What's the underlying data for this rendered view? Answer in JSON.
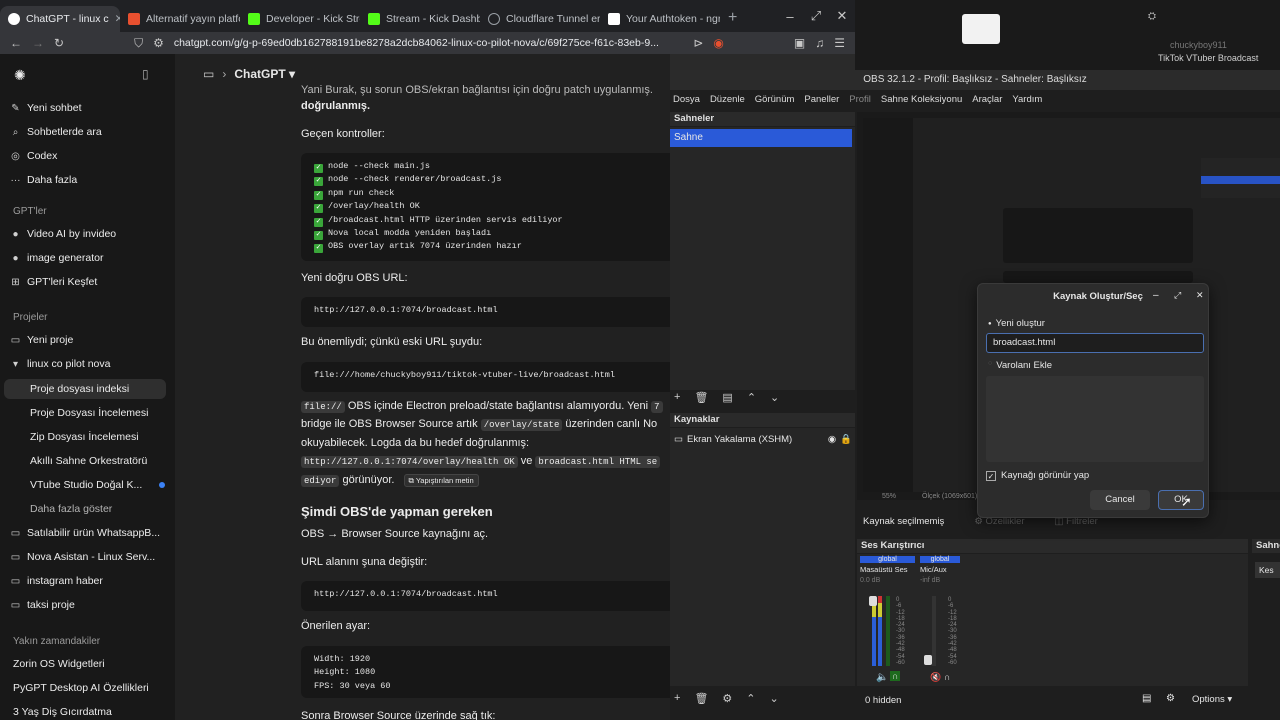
{
  "browser": {
    "tabs": [
      {
        "label": "ChatGPT - linux c",
        "color": "#ffffff",
        "active": true
      },
      {
        "label": "Alternatif yayın platfo",
        "color": "#e8502f"
      },
      {
        "label": "Developer - Kick Stre",
        "color": "#53fc18"
      },
      {
        "label": "Stream - Kick Dashb",
        "color": "#53fc18"
      },
      {
        "label": "Cloudflare Tunnel er",
        "color": "#9aa0a6"
      },
      {
        "label": "Your Authtoken - ngr",
        "color": "#ffffff"
      }
    ],
    "new_tab": "+",
    "url": "chatgpt.com/g/g-p-69ed0db162788191be8278a2dcb84062-linux-co-pilot-nova/c/69f275ce-f61c-83eb-9..."
  },
  "desktop": {
    "tiktok_title": "TikTok VTuber Broadcast",
    "top_right_text": "chuckyboy911"
  },
  "sidebar": {
    "top": [
      {
        "label": "Yeni sohbet",
        "icon": "edit-icon"
      },
      {
        "label": "Sohbetlerde ara",
        "icon": "search-icon"
      },
      {
        "label": "Codex",
        "icon": "codex-icon"
      },
      {
        "label": "Daha fazla",
        "icon": "more-icon"
      }
    ],
    "gpts_head": "GPT'ler",
    "gpts": [
      {
        "label": "Video AI by invideo"
      },
      {
        "label": "image generator"
      },
      {
        "label": "GPT'leri Keşfet"
      }
    ],
    "projects_head": "Projeler",
    "projects": [
      {
        "label": "Yeni proje"
      },
      {
        "label": "linux co pilot nova"
      },
      {
        "label": "Proje dosyası indeksi"
      },
      {
        "label": "Proje Dosyası İncelemesi"
      },
      {
        "label": "Zip Dosyası İncelemesi"
      },
      {
        "label": "Akıllı Sahne Orkestratörü"
      },
      {
        "label": "VTube Studio Doğal K..."
      },
      {
        "label": "Daha fazla göster"
      },
      {
        "label": "Satılabilir ürün WhatsappB..."
      },
      {
        "label": "Nova Asistan - Linux Serv..."
      },
      {
        "label": "instagram haber"
      },
      {
        "label": "taksi proje"
      }
    ],
    "recent_head": "Yakın zamandakiler",
    "recent": [
      {
        "label": "Zorin OS Widgetleri"
      },
      {
        "label": "PyGPT Desktop AI Özellikleri"
      },
      {
        "label": "3 Yaş Diş Gıcırdatma"
      }
    ]
  },
  "chat": {
    "header_title": "ChatGPT",
    "top_line": "Yani Burak, şu sorun OBS/ekran bağlantısı için doğru patch uygulanmış.",
    "top_line2": "doğrulanmış.",
    "passed_checks_label": "Geçen kontroller:",
    "checks": [
      "node --check main.js",
      "node --check renderer/broadcast.js",
      "npm run check",
      "/overlay/health OK",
      "/broadcast.html HTTP üzerinden servis ediliyor",
      "Nova local modda yeniden başladı",
      "OBS overlay artık 7074 üzerinden hazır"
    ],
    "new_url_label": "Yeni doğru OBS URL:",
    "new_url": "http://127.0.0.1:7074/broadcast.html",
    "important_label": "Bu önemliydi; çünkü eski URL şuydu:",
    "old_url": "file:///home/chuckyboy911/tiktok-vtuber-live/broadcast.html",
    "para_code1": "file://",
    "para_text1": " OBS içinde Electron preload/state bağlantısı alamıyordu. Yeni ",
    "para_code2": "7",
    "para_line2a": "bridge ile OBS Browser Source artık ",
    "para_code3": "/overlay/state",
    "para_line2b": " üzerinden canlı No",
    "para_line3": "okuyabilecek. Logda da bu hedef doğrulanmış:",
    "para_code4": "http://127.0.0.1:7074/overlay/health OK",
    "para_and": " ve ",
    "para_code5": "broadcast.html HTML se",
    "para_code6": "ediyor",
    "para_visible": " görünüyor.",
    "pasted_badge": "Yapıştırılan metin",
    "section_heading": "Şimdi OBS'de yapman gereken",
    "obs_step": "OBS → Browser Source kaynağını aç.",
    "url_change_label": "URL alanını şuna değiştir:",
    "url_again": "http://127.0.0.1:7074/broadcast.html",
    "suggested_label": "Önerilen ayar:",
    "settings": [
      "Width: 1920",
      "Height: 1080",
      "FPS: 30 veya 60"
    ],
    "bottom_line": "Sonra Browser Source üzerinde sağ tık:"
  },
  "obs": {
    "title": "OBS 32.1.2 - Profil: Başlıksız - Sahneler: Başlıksız",
    "menu": [
      "Dosya",
      "Düzenle",
      "Görünüm",
      "Paneller",
      "Profil",
      "Sahne Koleksiyonu",
      "Araçlar",
      "Yardım"
    ],
    "scenes_head": "Sahneler",
    "scene_item": "Sahne",
    "sources_head": "Kaynaklar",
    "source_item": "Ekran Yakalama (XSHM)",
    "no_source_selected": "Kaynak seçilmemiş",
    "properties_btn": "Özellikler",
    "filters_btn": "Filtreler",
    "mixer_head": "Ses Karıştırıcı",
    "mixer_channels": [
      {
        "tag": "global",
        "name": "Masaüstü Ses",
        "db": "0.0 dB"
      },
      {
        "tag": "global",
        "name": "Mic/Aux",
        "db": "-inf dB"
      }
    ],
    "scale_ticks": [
      "0",
      "-6",
      "-12",
      "-18",
      "-24",
      "-30",
      "-36",
      "-42",
      "-48",
      "-54",
      "-60"
    ],
    "hidden_label": "0 hidden",
    "options_label": "Options",
    "right_dock_head": "Sahne",
    "right_dock_btn": "Kes",
    "preview_zoom": "55%",
    "preview_res": "Ölçek (1069x601)"
  },
  "dialog": {
    "title": "Kaynak Oluştur/Seç",
    "create_new": "Yeni oluştur",
    "name_value": "broadcast.html",
    "add_existing": "Varolanı Ekle",
    "visible_checkbox": "Kaynağı görünür yap",
    "cancel": "Cancel",
    "ok": "OK"
  }
}
